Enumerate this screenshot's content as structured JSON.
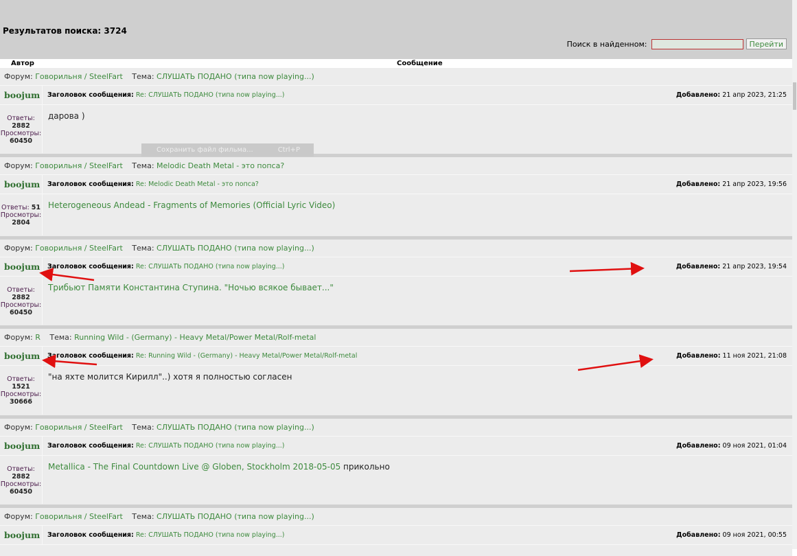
{
  "header": {
    "results_label": "Результатов поиска: 3724",
    "search_label": "Поиск в найденном:",
    "search_value": "",
    "go_button": "Перейти"
  },
  "columns": {
    "author": "Автор",
    "message": "Сообщение"
  },
  "labels": {
    "forum": "Форум:",
    "topic": "Тема:",
    "subject": "Заголовок сообщения:",
    "added": "Добавлено:",
    "replies": "Ответы:",
    "views": "Просмотры:"
  },
  "context_menu": {
    "item": "Сохранить файл фильма...",
    "shortcut": "Ctrl+P"
  },
  "posts": [
    {
      "forum": "Говорильня / SteelFart",
      "topic": "СЛУШАТЬ ПОДАНО (типа now playing...)",
      "author": "boojum",
      "subject": "Re: СЛУШАТЬ ПОДАНО (типа now playing...)",
      "date": "21 апр 2023, 21:25",
      "replies": "2882",
      "views": "60450",
      "message": "дарова )",
      "message_link": "",
      "message_tail": ""
    },
    {
      "forum": "Говорильня / SteelFart",
      "topic": "Melodic Death Metal - это попса?",
      "author": "boojum",
      "subject": "Re: Melodic Death Metal - это попса?",
      "date": "21 апр 2023, 19:56",
      "replies": "51",
      "views": "2804",
      "message": "",
      "message_link": "Heterogeneous Andead - Fragments of Memories (Official Lyric Video)",
      "message_tail": ""
    },
    {
      "forum": "Говорильня / SteelFart",
      "topic": "СЛУШАТЬ ПОДАНО (типа now playing...)",
      "author": "boojum",
      "subject": "Re: СЛУШАТЬ ПОДАНО (типа now playing...)",
      "date": "21 апр 2023, 19:54",
      "replies": "2882",
      "views": "60450",
      "message": "",
      "message_link": "Трибьют Памяти Константина Ступина. \"Ночью всякое бывает...\"",
      "message_tail": ""
    },
    {
      "forum": "R",
      "topic": "Running Wild - (Germany) - Heavy Metal/Power Metal/Rolf-metal",
      "author": "boojum",
      "subject": "Re: Running Wild - (Germany) - Heavy Metal/Power Metal/Rolf-metal",
      "date": "11 ноя 2021, 21:08",
      "replies": "1521",
      "views": "30666",
      "message": "\"на яхте молится Кирилл\"..) хотя я полностью согласен",
      "message_link": "",
      "message_tail": ""
    },
    {
      "forum": "Говорильня / SteelFart",
      "topic": "СЛУШАТЬ ПОДАНО (типа now playing...)",
      "author": "boojum",
      "subject": "Re: СЛУШАТЬ ПОДАНО (типа now playing...)",
      "date": "09 ноя 2021, 01:04",
      "replies": "2882",
      "views": "60450",
      "message": "",
      "message_link": "Metallica - The Final Countdown Live @ Globen, Stockholm 2018-05-05",
      "message_tail": " прикольно"
    },
    {
      "forum": "Говорильня / SteelFart",
      "topic": "СЛУШАТЬ ПОДАНО (типа now playing...)",
      "author": "boojum",
      "subject": "Re: СЛУШАТЬ ПОДАНО (типа now playing...)",
      "date": "09 ноя 2021, 00:55",
      "replies": "",
      "views": "",
      "message": "",
      "message_link": "",
      "message_tail": ""
    }
  ]
}
